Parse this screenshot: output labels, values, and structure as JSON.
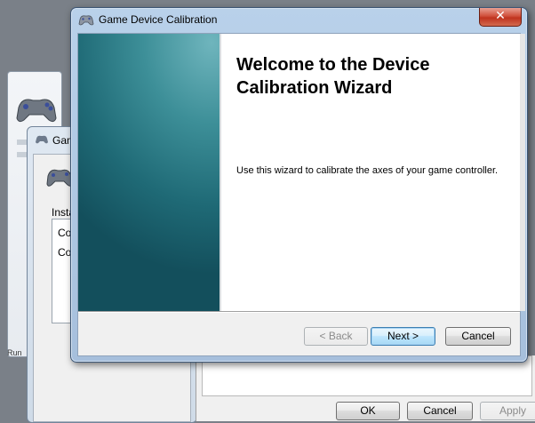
{
  "background_windows": {
    "window_b": {
      "title": "Gam",
      "group_label": "Insta",
      "list_items": [
        "Co",
        "Co"
      ],
      "footer_text": "Run"
    },
    "window_c": {
      "ok_label": "OK",
      "cancel_label": "Cancel",
      "apply_label": "Apply"
    }
  },
  "wizard": {
    "title": "Game Device Calibration",
    "close_glyph": "✕",
    "heading": "Welcome to the Device Calibration Wizard",
    "description": "Use this wizard to calibrate the axes of your game controller.",
    "buttons": {
      "back": "< Back",
      "next": "Next >",
      "cancel": "Cancel"
    }
  },
  "colors": {
    "banner_teal": "#1f6a76",
    "close_red": "#c0331e",
    "default_button_blue": "#3c7fb1"
  },
  "icons": {
    "app_icon": "gamepad-icon",
    "close_icon": "close-icon"
  }
}
